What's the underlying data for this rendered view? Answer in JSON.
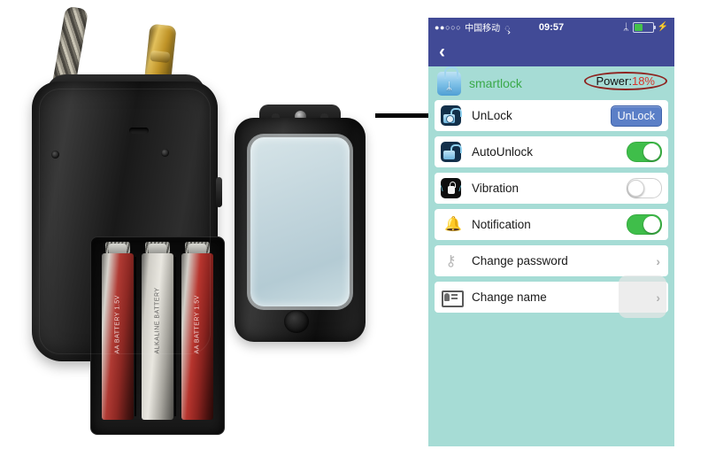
{
  "photo": {
    "caption_elements": {
      "lock_device": "padlock-with-battery-compartment",
      "battery_cover": "battery-cover-lid",
      "arrow_annotation": "arrow-pointing-to-power-indicator"
    },
    "batteries": [
      {
        "label": "AA BATTERY 1.5V"
      },
      {
        "label": "ALKALINE BATTERY"
      },
      {
        "label": "AA BATTERY 1.5V"
      }
    ]
  },
  "phone": {
    "status_bar": {
      "signal_dots": "●●○○○",
      "carrier": "中国移动",
      "wifi_icon": "ᯮ",
      "time": "09:57",
      "bluetooth_icon": "ᛦ",
      "charging_icon": "⚡"
    },
    "nav": {
      "back_label": "‹"
    },
    "header": {
      "app_title": "smartlock",
      "lock_icon_glyph": "ᛦ",
      "power_label": "Power:",
      "power_value": "18%"
    },
    "rows": [
      {
        "label": "UnLock",
        "icon": "unlock-hand-icon",
        "control": "button",
        "button_label": "UnLock"
      },
      {
        "label": "AutoUnlock",
        "icon": "open-padlock-icon",
        "control": "toggle",
        "state": "on"
      },
      {
        "label": "Vibration",
        "icon": "vibrating-padlock-icon",
        "control": "toggle",
        "state": "off"
      },
      {
        "label": "Notification",
        "icon": "bell-icon",
        "control": "toggle",
        "state": "on",
        "glyph": "🔔"
      },
      {
        "label": "Change password",
        "icon": "keys-icon",
        "control": "chevron",
        "chevron": "›",
        "glyph": "⚷"
      },
      {
        "label": "Change name",
        "icon": "id-card-icon",
        "control": "chevron",
        "chevron": "›",
        "pressed": true
      }
    ]
  },
  "colors": {
    "panel_background": "#a6dcd5",
    "status_bar": "#414a96",
    "app_title_green": "#3aa94a",
    "power_value_red": "#d9342b",
    "annotation_ellipse": "#8e2420",
    "toggle_on_green": "#3fbe4a",
    "unlock_button_blue": "#5b7fc7"
  }
}
